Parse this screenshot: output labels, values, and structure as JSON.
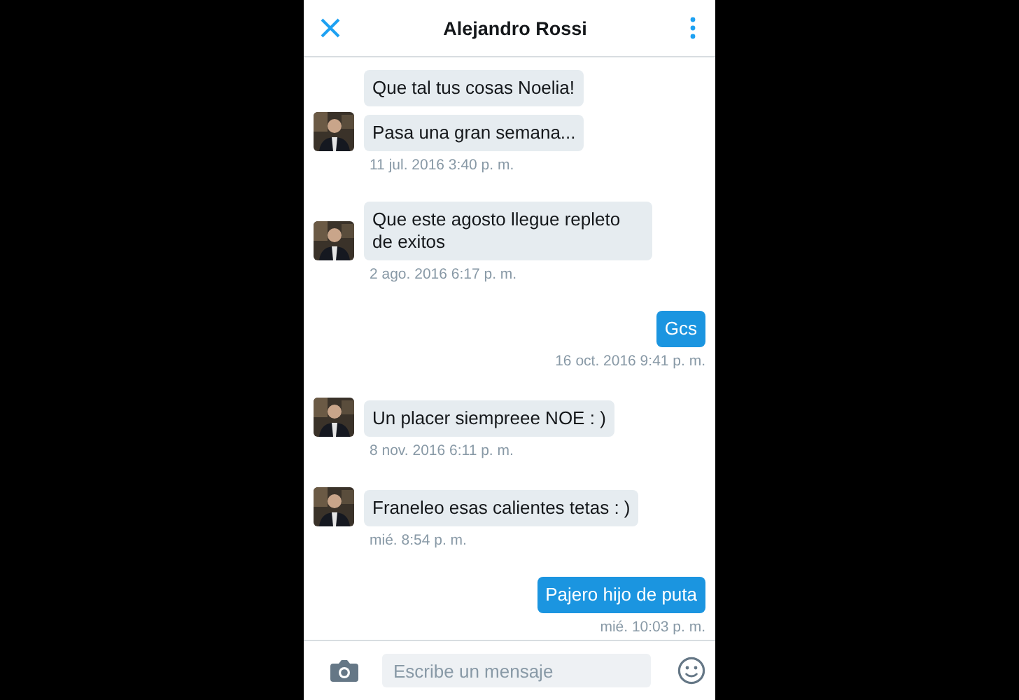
{
  "header": {
    "title": "Alejandro Rossi"
  },
  "messages": [
    {
      "kind": "received",
      "bubbles": [
        "Que tal tus cosas Noelia!",
        "Pasa una gran semana..."
      ],
      "time": "11 jul. 2016 3:40 p. m."
    },
    {
      "kind": "received",
      "bubbles": [
        "Que este agosto llegue repleto de exitos"
      ],
      "time": "2 ago. 2016 6:17 p. m."
    },
    {
      "kind": "sent",
      "bubbles": [
        "Gcs"
      ],
      "time": "16 oct. 2016 9:41 p. m."
    },
    {
      "kind": "received",
      "bubbles": [
        "Un placer siempreee NOE : )"
      ],
      "time": "8 nov. 2016 6:11 p. m."
    },
    {
      "kind": "received",
      "bubbles": [
        "Franeleo esas calientes tetas : )"
      ],
      "time": "mié. 8:54 p. m."
    },
    {
      "kind": "sent",
      "bubbles": [
        "Pajero hijo de puta"
      ],
      "time": "mié. 10:03 p. m."
    }
  ],
  "composer": {
    "placeholder": "Escribe un mensaje"
  }
}
